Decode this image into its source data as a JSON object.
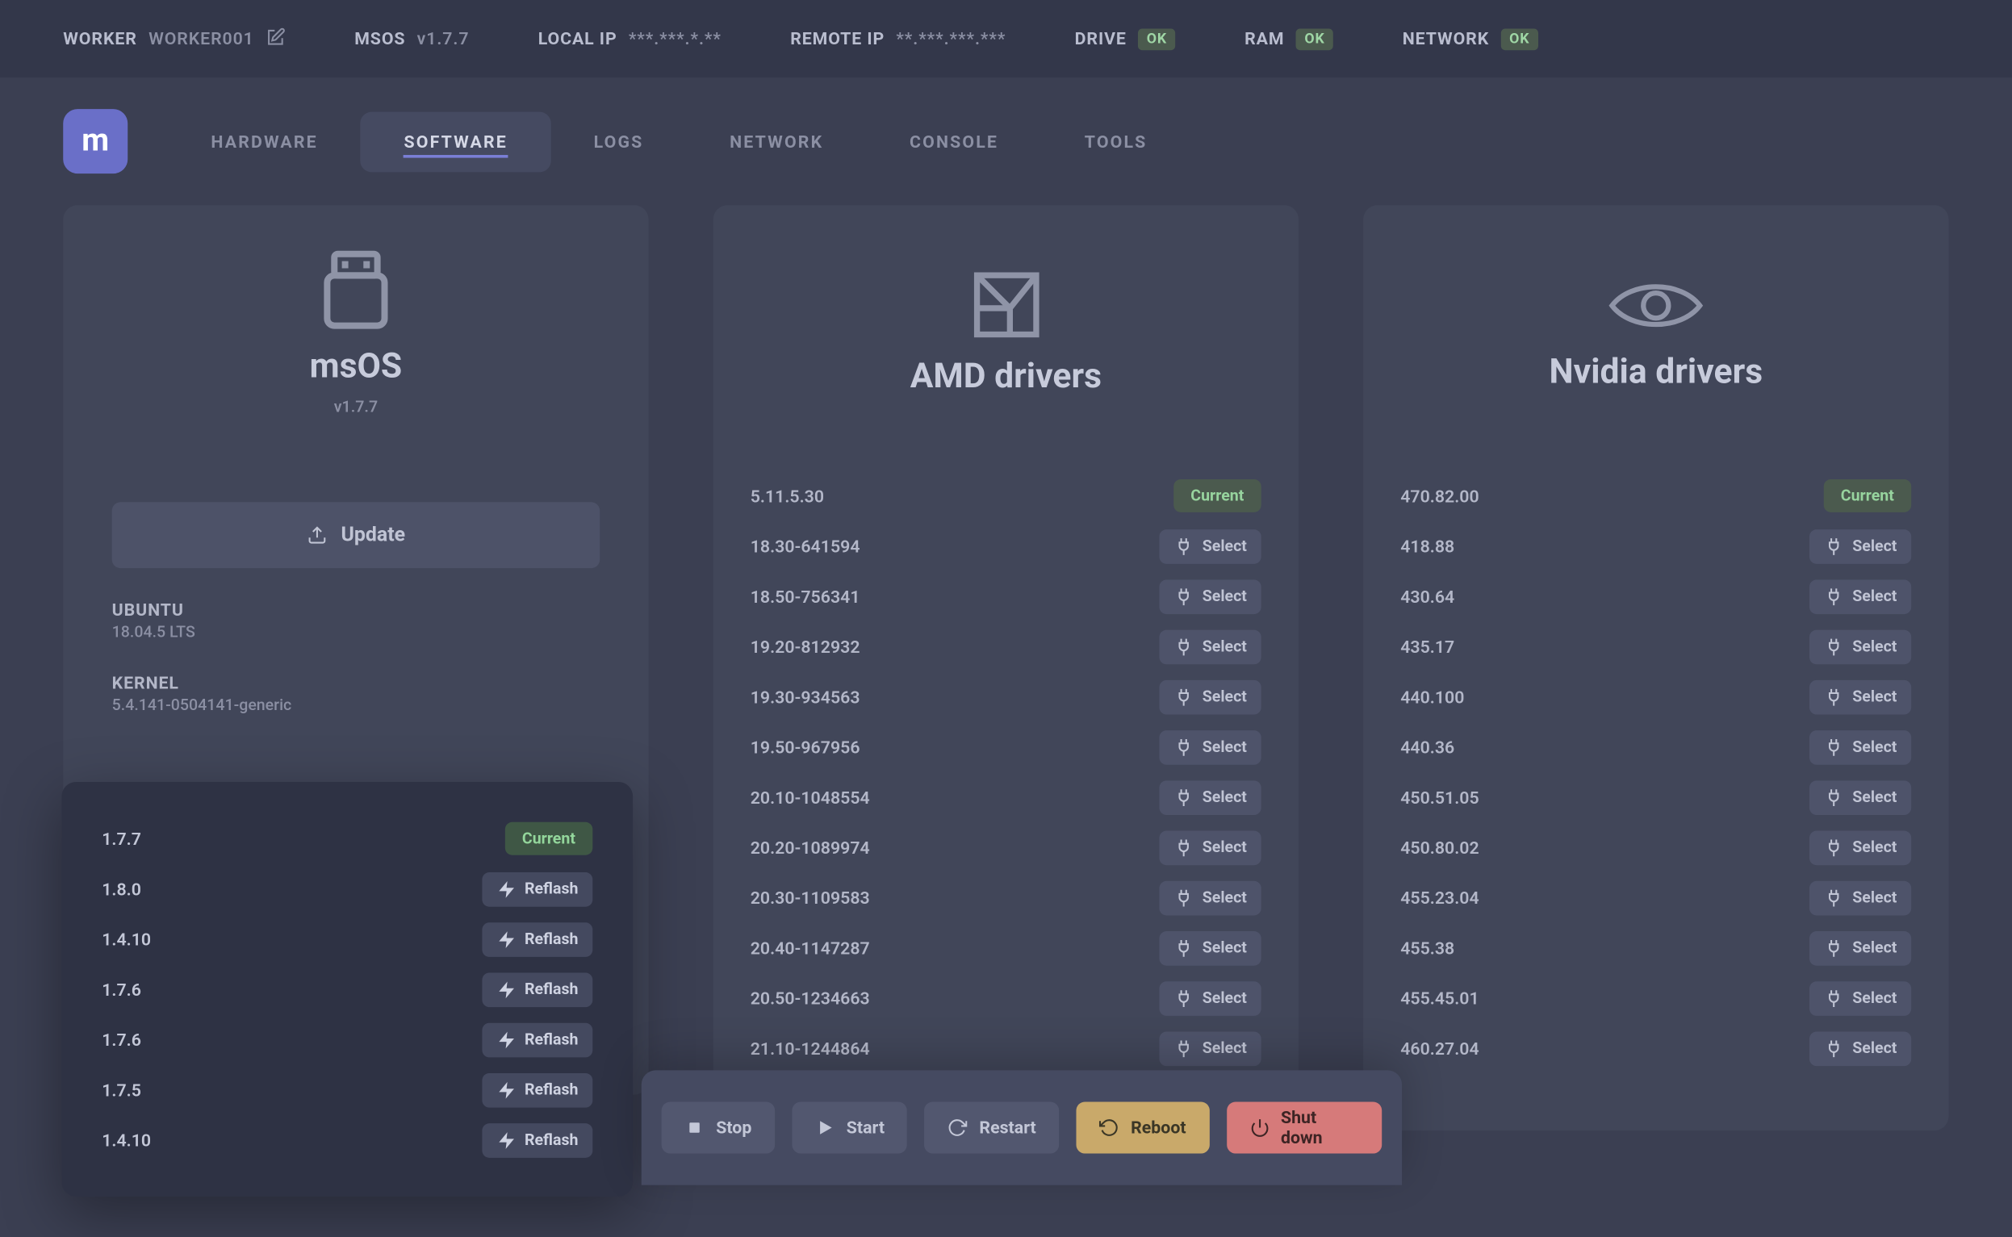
{
  "topbar": {
    "worker_label": "WORKER",
    "worker_value": "WORKER001",
    "msos_label": "MSOS",
    "msos_value": "v1.7.7",
    "localip_label": "LOCAL IP",
    "localip_value": "***.***.*.**",
    "remoteip_label": "REMOTE IP",
    "remoteip_value": "**.***.***.***",
    "drive_label": "DRIVE",
    "drive_badge": "OK",
    "ram_label": "RAM",
    "ram_badge": "OK",
    "network_label": "NETWORK",
    "network_badge": "OK"
  },
  "logo_letter": "m",
  "tabs": {
    "hardware": "HARDWARE",
    "software": "SOFTWARE",
    "logs": "LOGS",
    "network": "NETWORK",
    "console": "CONSOLE",
    "tools": "TOOLS"
  },
  "msos_card": {
    "title": "msOS",
    "subtitle": "v1.7.7",
    "update_label": "Update",
    "ubuntu_label": "UBUNTU",
    "ubuntu_value": "18.04.5 LTS",
    "kernel_label": "KERNEL",
    "kernel_value": "5.4.141-0504141-generic"
  },
  "amd_card": {
    "title": "AMD drivers",
    "current_label": "Current",
    "select_label": "Select",
    "versions": [
      {
        "v": "5.11.5.30",
        "current": true
      },
      {
        "v": "18.30-641594"
      },
      {
        "v": "18.50-756341"
      },
      {
        "v": "19.20-812932"
      },
      {
        "v": "19.30-934563"
      },
      {
        "v": "19.50-967956"
      },
      {
        "v": "20.10-1048554"
      },
      {
        "v": "20.20-1089974"
      },
      {
        "v": "20.30-1109583"
      },
      {
        "v": "20.40-1147287"
      },
      {
        "v": "20.50-1234663"
      },
      {
        "v": "21.10-1244864"
      }
    ]
  },
  "nvidia_card": {
    "title": "Nvidia drivers",
    "current_label": "Current",
    "select_label": "Select",
    "versions": [
      {
        "v": "470.82.00",
        "current": true
      },
      {
        "v": "418.88"
      },
      {
        "v": "430.64"
      },
      {
        "v": "435.17"
      },
      {
        "v": "440.100"
      },
      {
        "v": "440.36"
      },
      {
        "v": "450.51.05"
      },
      {
        "v": "450.80.02"
      },
      {
        "v": "455.23.04"
      },
      {
        "v": "455.38"
      },
      {
        "v": "455.45.01"
      },
      {
        "v": "460.27.04"
      }
    ]
  },
  "popover": {
    "current_label": "Current",
    "reflash_label": "Reflash",
    "rows": [
      {
        "v": "1.7.7",
        "current": true
      },
      {
        "v": "1.8.0"
      },
      {
        "v": "1.4.10"
      },
      {
        "v": "1.7.6"
      },
      {
        "v": "1.7.6"
      },
      {
        "v": "1.7.5"
      },
      {
        "v": "1.4.10"
      }
    ]
  },
  "actions": {
    "stop": "Stop",
    "start": "Start",
    "restart": "Restart",
    "reboot": "Reboot",
    "shutdown": "Shut down"
  }
}
